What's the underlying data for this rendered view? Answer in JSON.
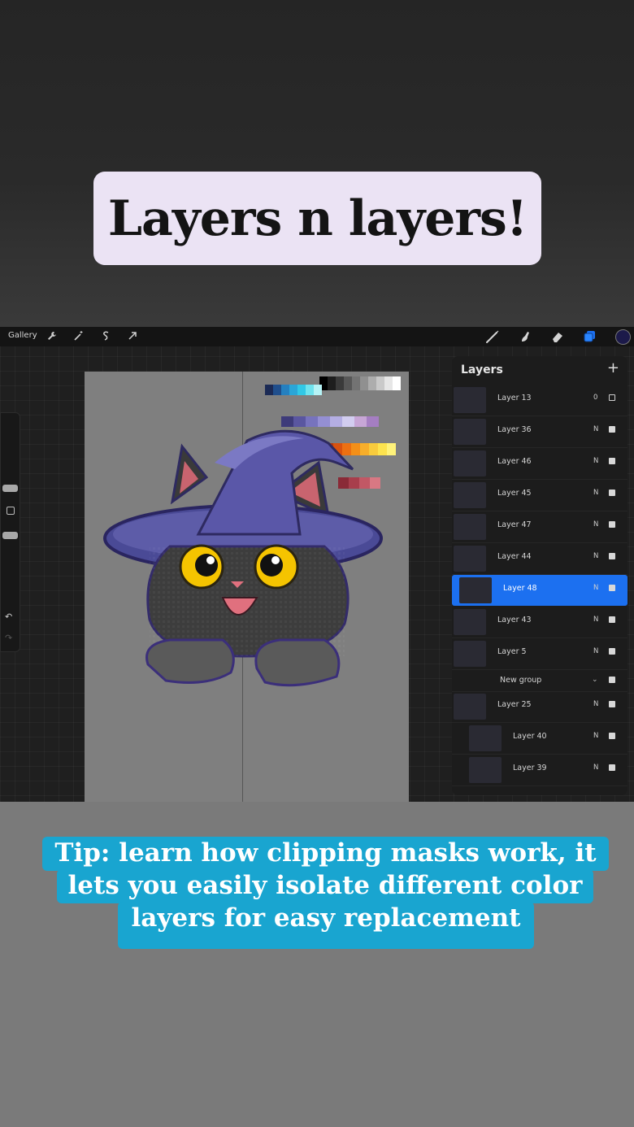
{
  "title": "Layers n layers!",
  "app": {
    "gallery_label": "Gallery",
    "toolbar_icons": [
      "wrench-icon",
      "magic-wand-icon",
      "selection-icon",
      "move-arrow-icon"
    ],
    "tools": [
      "brush-icon",
      "smudge-icon",
      "eraser-icon",
      "layers-icon"
    ],
    "active_color": "#1c1a4a",
    "undo_icon": "↶",
    "redo_icon": "↷"
  },
  "layers_panel": {
    "header": "Layers",
    "add_icon": "+",
    "layers": [
      {
        "name": "Layer 13",
        "mode": "0",
        "visible": false
      },
      {
        "name": "Layer 36",
        "mode": "N",
        "visible": true
      },
      {
        "name": "Layer 46",
        "mode": "N",
        "visible": true
      },
      {
        "name": "Layer 45",
        "mode": "N",
        "visible": true
      },
      {
        "name": "Layer 47",
        "mode": "N",
        "visible": true
      },
      {
        "name": "Layer 44",
        "mode": "N",
        "visible": true
      },
      {
        "name": "Layer 48",
        "mode": "N",
        "visible": true,
        "selected": true
      },
      {
        "name": "Layer 43",
        "mode": "N",
        "visible": true
      },
      {
        "name": "Layer 5",
        "mode": "N",
        "visible": true
      }
    ],
    "group": {
      "name": "New group",
      "visible": true
    },
    "group_layers": [
      {
        "name": "Layer 25",
        "mode": "N",
        "visible": true
      },
      {
        "name": "Layer 40",
        "mode": "N",
        "visible": true
      },
      {
        "name": "Layer 39",
        "mode": "N",
        "visible": true
      }
    ]
  },
  "palette_colors": {
    "grays": [
      "#000000",
      "#1e1e1e",
      "#3a3a3a",
      "#575757",
      "#737373",
      "#909090",
      "#adadad",
      "#c9c9c9",
      "#e6e6e6",
      "#ffffff"
    ],
    "blues": [
      "#1b2a55",
      "#1f4e8c",
      "#2580c0",
      "#2aa6d8",
      "#31c8e6",
      "#6fe3ee",
      "#b6f3f6"
    ],
    "purples": [
      "#3e3b7a",
      "#5a56a0",
      "#7773bd",
      "#948fd3",
      "#b4aee3",
      "#d2cdf0",
      "#c7a6d6",
      "#a57ec2"
    ],
    "oranges": [
      "#b83a0d",
      "#d9520f",
      "#ec7012",
      "#f38f18",
      "#f7ae2a",
      "#f8cb3c",
      "#fde34e",
      "#fff27a"
    ],
    "reds": [
      "#8a2a37",
      "#a83e4c",
      "#c25865",
      "#d87883"
    ]
  },
  "tip": {
    "line1": "Tip: learn how clipping masks work, it",
    "line2": "lets you easily isolate different color",
    "line3": "layers for easy replacement"
  }
}
